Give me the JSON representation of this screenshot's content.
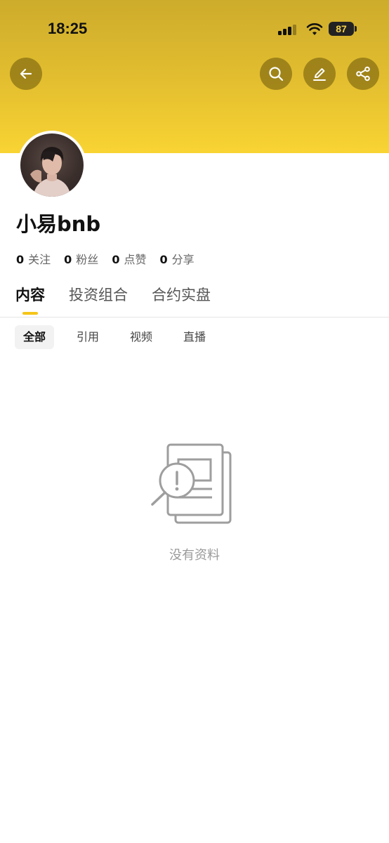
{
  "status_bar": {
    "time": "18:25",
    "battery": "87"
  },
  "header": {
    "back_icon": "arrow-left-icon",
    "actions": [
      "search-icon",
      "edit-icon",
      "share-icon"
    ],
    "gradient_colors": [
      "#cdac2c",
      "#f9d433"
    ]
  },
  "profile": {
    "name": "小易bnb",
    "stats": [
      {
        "value": "0",
        "label": "关注"
      },
      {
        "value": "0",
        "label": "粉丝"
      },
      {
        "value": "0",
        "label": "点赞"
      },
      {
        "value": "0",
        "label": "分享"
      }
    ]
  },
  "tabs": [
    {
      "label": "内容",
      "active": true
    },
    {
      "label": "投资组合",
      "active": false
    },
    {
      "label": "合约实盘",
      "active": false
    }
  ],
  "filters": [
    {
      "label": "全部",
      "active": true
    },
    {
      "label": "引用",
      "active": false
    },
    {
      "label": "视频",
      "active": false
    },
    {
      "label": "直播",
      "active": false
    }
  ],
  "empty_state": {
    "icon": "no-data-icon",
    "message": "没有资料"
  },
  "colors": {
    "accent": "#f5c518"
  }
}
